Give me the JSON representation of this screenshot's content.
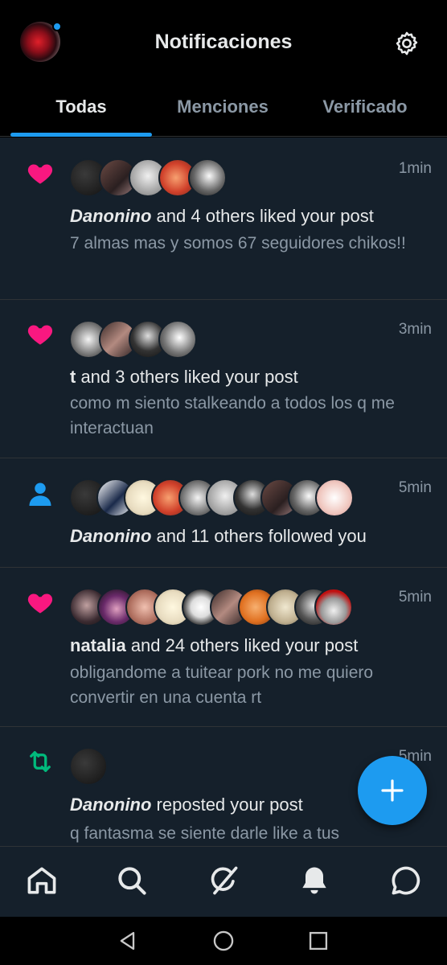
{
  "header": {
    "title": "Notificaciones",
    "accent": "#1d9bf0"
  },
  "tabs": [
    {
      "label": "Todas",
      "active": true
    },
    {
      "label": "Menciones",
      "active": false
    },
    {
      "label": "Verificado",
      "active": false
    }
  ],
  "notifications": [
    {
      "kind": "like",
      "kind_icon": "heart-icon",
      "avatar_count": 5,
      "actor": "Danonino",
      "rest": " and 4 others liked your post",
      "time": "1min",
      "text": "7 almas mas y somos 67 seguidores chikos!!"
    },
    {
      "kind": "like",
      "kind_icon": "heart-icon",
      "avatar_count": 4,
      "actor": "t",
      "rest": " and 3 others liked your post",
      "time": "3min",
      "text": "como m siento stalkeando a todos los q me interactuan"
    },
    {
      "kind": "follow",
      "kind_icon": "person-icon",
      "avatar_count": 10,
      "actor": "Danonino",
      "rest": " and 11 others followed you",
      "time": "5min",
      "text": ""
    },
    {
      "kind": "like",
      "kind_icon": "heart-icon",
      "avatar_count": 10,
      "actor": "natalia",
      "rest": " and 24 others liked your post",
      "time": "5min",
      "text": "obligandome a tuitear pork no me quiero convertir en una cuenta rt"
    },
    {
      "kind": "repost",
      "kind_icon": "repost-icon",
      "avatar_count": 1,
      "actor": "Danonino",
      "rest": " reposted your post",
      "time": "5min",
      "text": "q fantasma se siente darle like a tus"
    }
  ],
  "colors": {
    "like": "#f91880",
    "follow": "#1d9bf0",
    "repost": "#00ba7c",
    "background": "#15202b",
    "secondary_text": "#8b98a5"
  },
  "bottom_nav": [
    "home-icon",
    "search-icon",
    "grok-icon",
    "bell-icon",
    "messages-icon"
  ],
  "system_nav": [
    "back-icon",
    "home-circle-icon",
    "recents-icon"
  ]
}
